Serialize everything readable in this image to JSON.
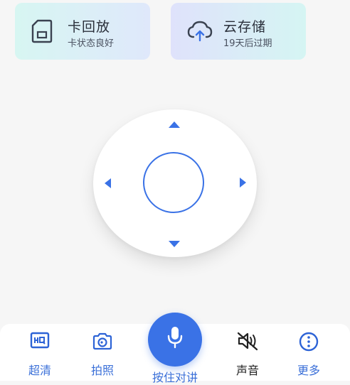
{
  "cards": [
    {
      "title": "卡回放",
      "subtitle": "卡状态良好",
      "icon": "sd-card-icon"
    },
    {
      "title": "云存储",
      "subtitle": "19天后过期",
      "icon": "cloud-upload-icon"
    }
  ],
  "controls": {
    "hd": {
      "label": "超清",
      "icon": "hq-icon"
    },
    "snapshot": {
      "label": "拍照",
      "icon": "camera-icon"
    },
    "talk": {
      "label": "按住对讲",
      "icon": "microphone-icon"
    },
    "sound": {
      "label": "声音",
      "icon": "speaker-muted-icon"
    },
    "more": {
      "label": "更多",
      "icon": "more-icon"
    }
  },
  "colors": {
    "accent": "#3a72e6",
    "background": "#f6f6f6"
  }
}
